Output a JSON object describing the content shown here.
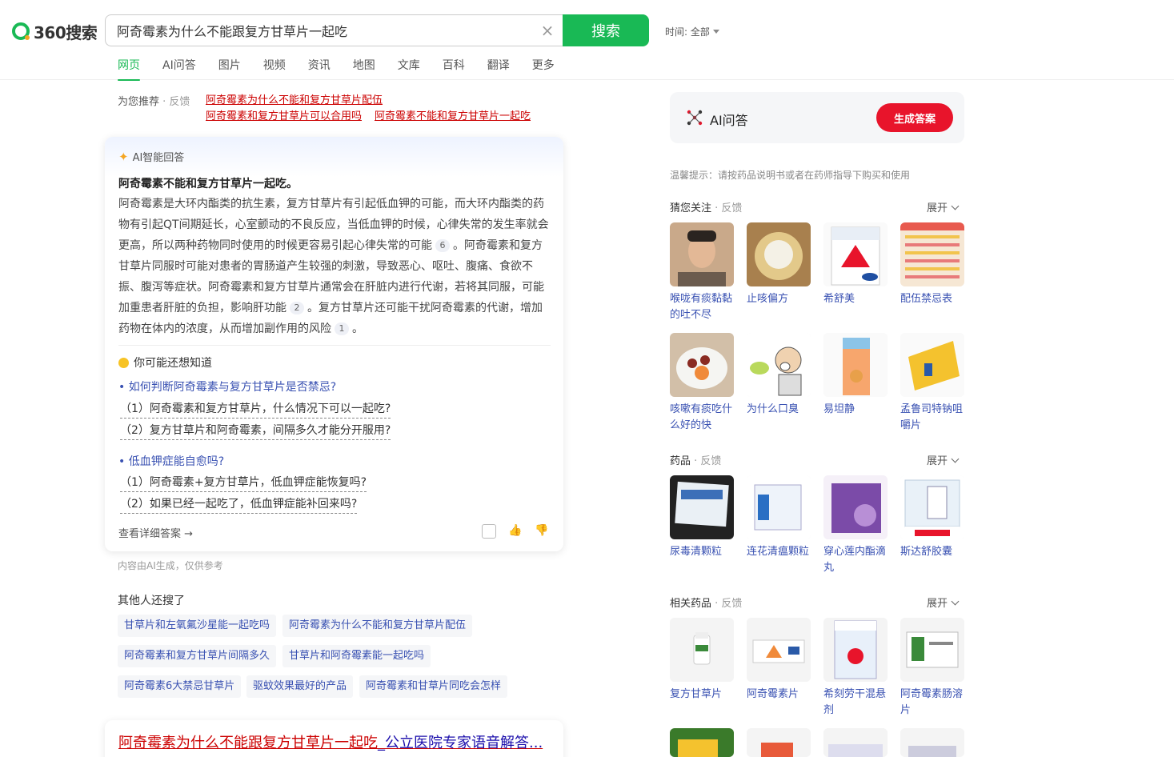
{
  "brand": {
    "logo_text": "360搜索",
    "accent": "#19b955"
  },
  "search": {
    "query": "阿奇霉素为什么不能跟复方甘草片一起吃",
    "button": "搜索",
    "time_filter": "时间: 全部"
  },
  "tabs": [
    "网页",
    "AI问答",
    "图片",
    "视频",
    "资讯",
    "地图",
    "文库",
    "百科",
    "翻译",
    "更多"
  ],
  "recommend": {
    "label": "为您推荐",
    "feedback": "· 反馈",
    "links": [
      "阿奇霉素为什么不能和复方甘草片配伍",
      "阿奇霉素和复方甘草片可以合用吗",
      "阿奇霉素不能和复方甘草片一起吃"
    ]
  },
  "ai_answer": {
    "header": "AI智能回答",
    "title": "阿奇霉素不能和复方甘草片一起吃。",
    "body_1": "阿奇霉素是大环内酯类的抗生素，复方甘草片有引起低血钾的可能，而大环内酯类的药物有引起QT间期延长，心室颤动的不良反应，当低血钾的时候，心律失常的发生率就会更高，所以两种药物同时使用的时候更容易引起心律失常的可能",
    "cite_1": "6",
    "body_2": "。阿奇霉素和复方甘草片同服时可能对患者的胃肠道产生较强的刺激，导致恶心、呕吐、腹痛、食欲不振、腹泻等症状。阿奇霉素和复方甘草片通常会在肝脏内进行代谢，若将其同服，可能加重患者肝脏的负担，影响肝功能",
    "cite_2": "2",
    "body_3": "。复方甘草片还可能干扰阿奇霉素的代谢，增加药物在体内的浓度，从而增加副作用的风险",
    "cite_3": "1",
    "body_4": "。",
    "know_title": "你可能还想知道",
    "q1": "如何判断阿奇霉素与复方甘草片是否禁忌?",
    "q1_subs": [
      "（1）阿奇霉素和复方甘草片，什么情况下可以一起吃?",
      "（2）复方甘草片和阿奇霉素，间隔多久才能分开服用?"
    ],
    "q2": "低血钾症能自愈吗?",
    "q2_subs": [
      "（1）阿奇霉素+复方甘草片，低血钾症能恢复吗?",
      "（2）如果已经一起吃了，低血钾症能补回来吗?"
    ],
    "detail": "查看详细答案 →",
    "note": "内容由AI生成，仅供参考"
  },
  "others": {
    "title": "其他人还搜了",
    "chips": [
      "甘草片和左氧氟沙星能一起吃吗",
      "阿奇霉素为什么不能和复方甘草片配伍",
      "阿奇霉素和复方甘草片间隔多久",
      "甘草片和阿奇霉素能一起吃吗",
      "阿奇霉素6大禁忌甘草片",
      "驱蚊效果最好的产品",
      "阿奇霉素和甘草片同吃会怎样"
    ]
  },
  "result": {
    "title_red": "阿奇霉素为什么不能跟复方甘草片一起吃",
    "title_blue": "_公立医院专家语音解答..."
  },
  "right": {
    "ai_label": "AI问答",
    "gen_button": "生成答案",
    "tip": "温馨提示：请按药品说明书或者在药师指导下购买和使用",
    "expand": "展开",
    "feedback": "· 反馈",
    "sec1_title": "猜您关注",
    "sec1": [
      "喉咙有痰黏黏的吐不尽",
      "止咳偏方",
      "希舒美",
      "配伍禁忌表",
      "咳嗽有痰吃什么好的快",
      "为什么口臭",
      "易坦静",
      "孟鲁司特钠咀嚼片"
    ],
    "sec2_title": "药品",
    "sec2": [
      "尿毒清颗粒",
      "连花清瘟颗粒",
      "穿心莲内酯滴丸",
      "斯达舒胶囊"
    ],
    "sec3_title": "相关药品",
    "sec3": [
      "复方甘草片",
      "阿奇霉素片",
      "希刻劳干混悬剂",
      "阿奇霉素肠溶片"
    ]
  }
}
